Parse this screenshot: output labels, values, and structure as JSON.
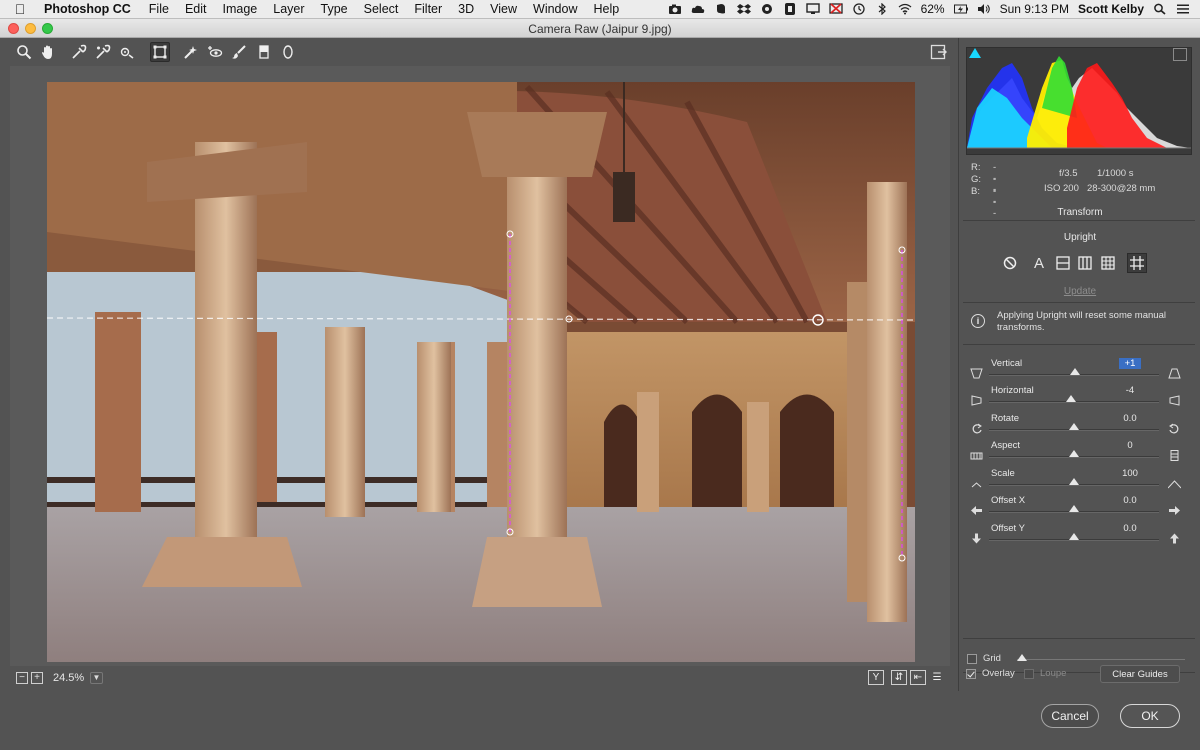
{
  "menubar": {
    "app_name": "Photoshop CC",
    "menus": [
      "File",
      "Edit",
      "Image",
      "Layer",
      "Type",
      "Select",
      "Filter",
      "3D",
      "View",
      "Window",
      "Help"
    ],
    "battery": "62%",
    "clock": "Sun 9:13 PM",
    "user": "Scott Kelby"
  },
  "window": {
    "title": "Camera Raw (Jaipur 9.jpg)"
  },
  "preview": {
    "zoom": "24.5%"
  },
  "readout": {
    "r_label": "R:",
    "g_label": "G:",
    "b_label": "B:",
    "r_value": "---",
    "g_value": "---",
    "b_value": "---",
    "aperture": "f/3.5",
    "shutter": "1/1000 s",
    "iso": "ISO 200",
    "lens": "28-300@28 mm"
  },
  "panel": {
    "section_title": "Transform",
    "upright_title": "Upright",
    "update_label": "Update",
    "info_text": "Applying Upright will reset some manual transforms.",
    "sliders": [
      {
        "label": "Vertical",
        "value": "+1",
        "position": 0.505
      },
      {
        "label": "Horizontal",
        "value": "-4",
        "position": 0.48
      },
      {
        "label": "Rotate",
        "value": "0.0",
        "position": 0.5
      },
      {
        "label": "Aspect",
        "value": "0",
        "position": 0.5
      },
      {
        "label": "Scale",
        "value": "100",
        "position": 0.5
      },
      {
        "label": "Offset X",
        "value": "0.0",
        "position": 0.5
      },
      {
        "label": "Offset Y",
        "value": "0.0",
        "position": 0.5
      }
    ],
    "grid_label": "Grid",
    "overlay_label": "Overlay",
    "loupe_label": "Loupe",
    "clear_guides_label": "Clear Guides"
  },
  "dialog": {
    "cancel_label": "Cancel",
    "ok_label": "OK"
  },
  "colors": {
    "panel_bg": "#535353",
    "selected_value": "#3a6fc4",
    "guide_color": "#e040fb"
  }
}
